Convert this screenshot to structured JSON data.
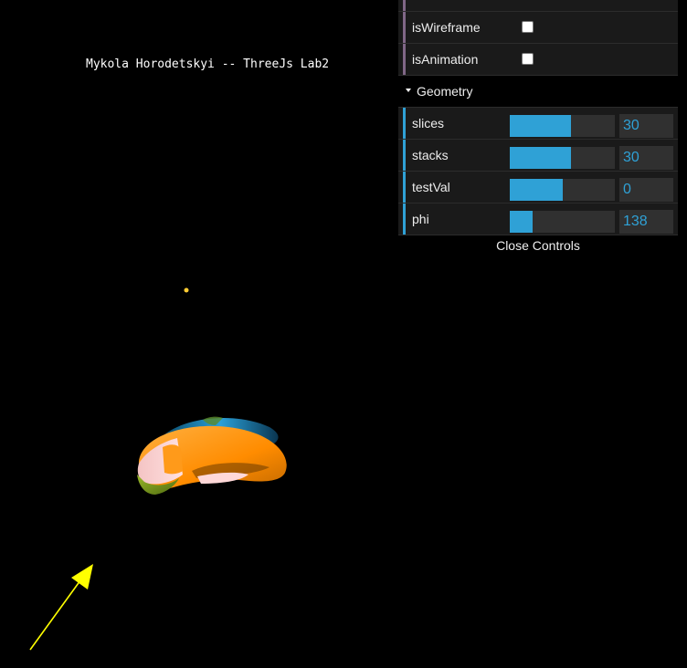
{
  "scene": {
    "title": "Mykola Horodetskyi -- ThreeJs Lab2"
  },
  "controls": {
    "booleans": [
      {
        "label": "isWireframe",
        "checked": false
      },
      {
        "label": "isAnimation",
        "checked": false
      }
    ],
    "geometry_folder": {
      "label": "Geometry",
      "sliders": [
        {
          "label": "slices",
          "value": "30",
          "fraction": 0.58
        },
        {
          "label": "stacks",
          "value": "30",
          "fraction": 0.58
        },
        {
          "label": "testVal",
          "value": "0",
          "fraction": 0.5
        },
        {
          "label": "phi",
          "value": "138",
          "fraction": 0.22
        }
      ]
    },
    "close_label": "Close Controls"
  },
  "colors": {
    "slider_accent": "#2fa1d6",
    "boolean_stripe": "#806787",
    "number_stripe": "#2fa1d6",
    "arrow": "#ffff00",
    "light_point": "#ffcc33"
  }
}
